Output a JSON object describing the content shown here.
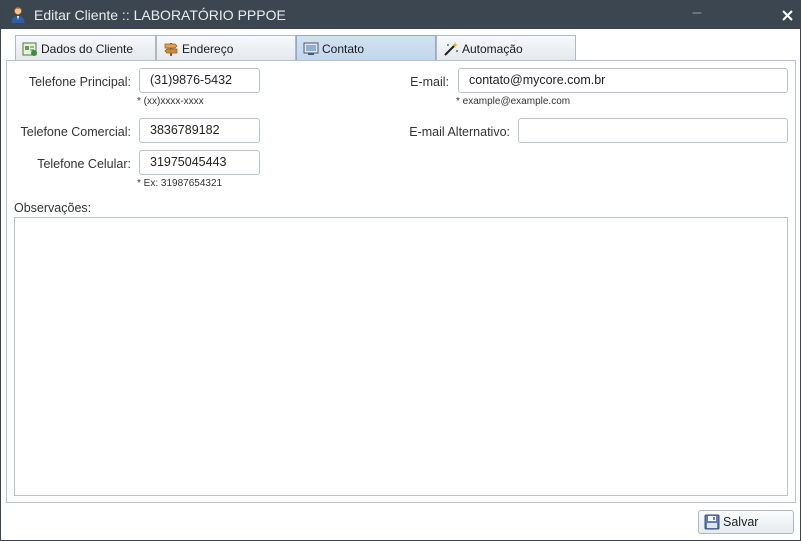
{
  "window": {
    "title": "Editar Cliente :: LABORATÓRIO PPPOE",
    "minimize_glyph": "–"
  },
  "tabs": [
    {
      "label": "Dados do Cliente",
      "icon": "client-data-icon",
      "active": false
    },
    {
      "label": "Endereço",
      "icon": "signpost-icon",
      "active": false
    },
    {
      "label": "Contato",
      "icon": "monitor-icon",
      "active": true
    },
    {
      "label": "Automação",
      "icon": "magic-wand-icon",
      "active": false
    }
  ],
  "contact": {
    "phone_main": {
      "label": "Telefone Principal:",
      "value": "(31)9876-5432",
      "hint": "* (xx)xxxx-xxxx"
    },
    "phone_commercial": {
      "label": "Telefone Comercial:",
      "value": "3836789182"
    },
    "phone_mobile": {
      "label": "Telefone Celular:",
      "value": "31975045443",
      "hint": "* Ex: 31987654321"
    },
    "email": {
      "label": "E-mail:",
      "value": "contato@mycore.com.br",
      "hint": "* example@example.com"
    },
    "email_alt": {
      "label": "E-mail Alternativo:",
      "value": ""
    },
    "notes": {
      "label": "Observações:",
      "value": ""
    }
  },
  "footer": {
    "save_label": "Salvar"
  },
  "colors": {
    "titlebar": "#3b4651",
    "active_tab": "#c8daee",
    "border": "#b7c3cf"
  }
}
